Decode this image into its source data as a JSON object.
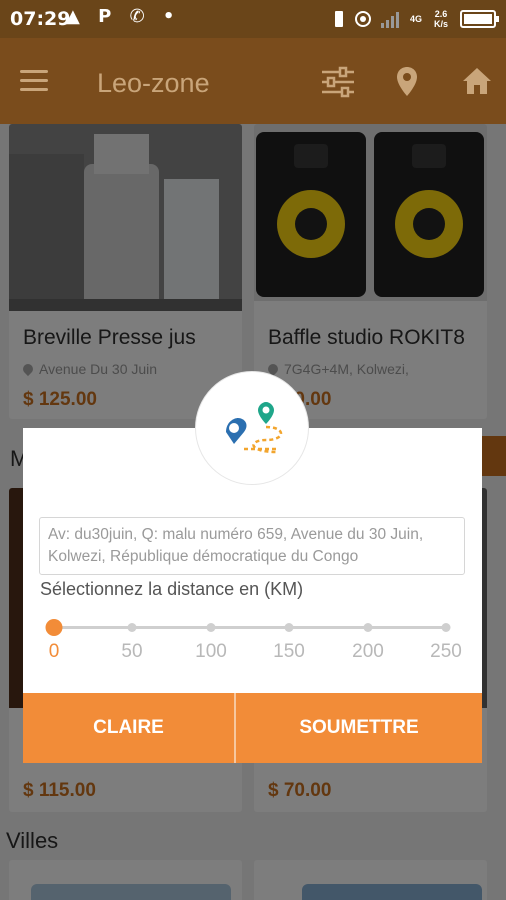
{
  "status_bar": {
    "time": "07:29",
    "left_icons": "▲ P ✆ •",
    "network": "4G",
    "speed": "2.6 K/s"
  },
  "app_bar": {
    "title": "Leo-zone"
  },
  "products": [
    {
      "name": "Breville Presse jus",
      "location": "Avenue Du 30 Juin",
      "price": "$ 125.00"
    },
    {
      "name": "Baffle studio ROKIT8",
      "location": "7G4G+4M, Kolwezi,",
      "price": "$ 70.00"
    },
    {
      "price": "$ 115.00"
    },
    {
      "price": "$ 70.00"
    }
  ],
  "section_partial_label": "M",
  "cities_label": "Villes",
  "dialog": {
    "address": "Av: du30juin, Q: malu numéro 659, Avenue du 30 Juin, Kolwezi, République démocratique du Congo",
    "distance_label": "Sélectionnez la distance en (KM)",
    "slider_ticks": [
      "0",
      "50",
      "100",
      "150",
      "200",
      "250"
    ],
    "slider_value": 0,
    "clear_label": "CLAIRE",
    "submit_label": "SOUMETTRE"
  },
  "colors": {
    "accent": "#f28c38",
    "app_bar": "#7a4c1c",
    "price": "#b5651d"
  }
}
